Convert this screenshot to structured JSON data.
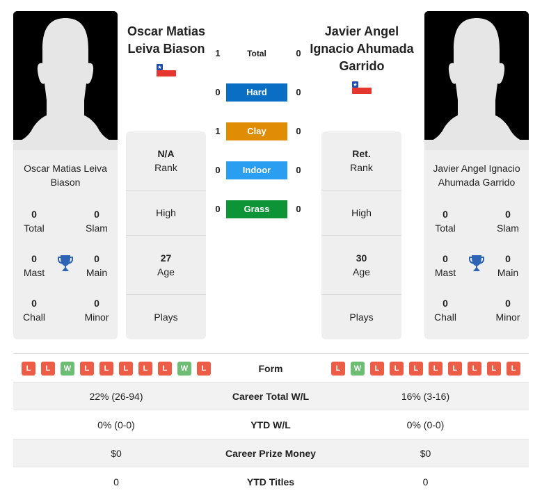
{
  "colors": {
    "hard": "#0a6ec4",
    "clay": "#e08d05",
    "indoor": "#2a9ef0",
    "grass": "#0d9436",
    "loss": "#ec5c46",
    "win": "#6dbd74",
    "trophy": "#2e64b5"
  },
  "player1": {
    "name": "Oscar Matias Leiva Biason",
    "name_line1": "Oscar Matias",
    "name_line2": "Leiva Biason",
    "flag": "chile-flag",
    "photo": "silhouette-placeholder",
    "card_name": "Oscar Matias Leiva Biason",
    "titles": {
      "total": {
        "value": "0",
        "label": "Total"
      },
      "slam": {
        "value": "0",
        "label": "Slam"
      },
      "mast": {
        "value": "0",
        "label": "Mast"
      },
      "main": {
        "value": "0",
        "label": "Main"
      },
      "chall": {
        "value": "0",
        "label": "Chall"
      },
      "minor": {
        "value": "0",
        "label": "Minor"
      }
    },
    "info": {
      "rank": {
        "value": "N/A",
        "label": "Rank"
      },
      "high": {
        "value": "",
        "label": "High"
      },
      "age": {
        "value": "27",
        "label": "Age"
      },
      "plays": {
        "value": "",
        "label": "Plays"
      }
    },
    "form": [
      "L",
      "L",
      "W",
      "L",
      "L",
      "L",
      "L",
      "L",
      "W",
      "L"
    ]
  },
  "player2": {
    "name": "Javier Angel Ignacio Ahumada Garrido",
    "name_line1": "Javier Angel",
    "name_line2": "Ignacio Ahumada",
    "name_line3": "Garrido",
    "flag": "chile-flag",
    "photo": "silhouette-placeholder",
    "card_name": "Javier Angel Ignacio Ahumada Garrido",
    "titles": {
      "total": {
        "value": "0",
        "label": "Total"
      },
      "slam": {
        "value": "0",
        "label": "Slam"
      },
      "mast": {
        "value": "0",
        "label": "Mast"
      },
      "main": {
        "value": "0",
        "label": "Main"
      },
      "chall": {
        "value": "0",
        "label": "Chall"
      },
      "minor": {
        "value": "0",
        "label": "Minor"
      }
    },
    "info": {
      "rank": {
        "value": "Ret.",
        "label": "Rank"
      },
      "high": {
        "value": "",
        "label": "High"
      },
      "age": {
        "value": "30",
        "label": "Age"
      },
      "plays": {
        "value": "",
        "label": "Plays"
      }
    },
    "form": [
      "L",
      "W",
      "L",
      "L",
      "L",
      "L",
      "L",
      "L",
      "L",
      "L"
    ]
  },
  "h2h": {
    "total": {
      "label": "Total",
      "p1": "1",
      "p2": "0"
    },
    "hard": {
      "label": "Hard",
      "p1": "0",
      "p2": "0"
    },
    "clay": {
      "label": "Clay",
      "p1": "1",
      "p2": "0"
    },
    "indoor": {
      "label": "Indoor",
      "p1": "0",
      "p2": "0"
    },
    "grass": {
      "label": "Grass",
      "p1": "0",
      "p2": "0"
    }
  },
  "table": {
    "form_label": "Form",
    "rows": [
      {
        "label": "Career Total W/L",
        "p1": "22% (26-94)",
        "p2": "16% (3-16)"
      },
      {
        "label": "YTD W/L",
        "p1": "0% (0-0)",
        "p2": "0% (0-0)"
      },
      {
        "label": "Career Prize Money",
        "p1": "$0",
        "p2": "$0"
      },
      {
        "label": "YTD Titles",
        "p1": "0",
        "p2": "0"
      }
    ]
  }
}
